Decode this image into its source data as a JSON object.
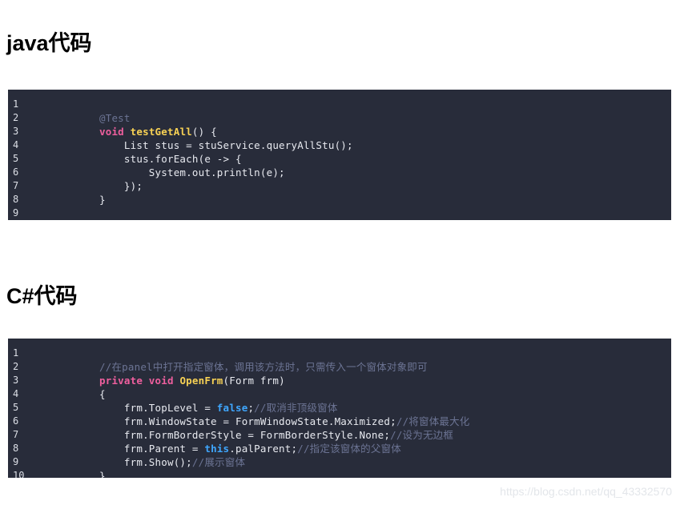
{
  "page": {
    "background_color": "#ffffff",
    "watermark": "https://blog.csdn.net/qq_43332570"
  },
  "sections": [
    {
      "id": "java",
      "heading": "java代码",
      "code_block": {
        "background_color": "#282c3a",
        "line_numbers": [
          "1",
          "2",
          "3",
          "4",
          "5",
          "6",
          "7",
          "8",
          "9"
        ],
        "lines": [
          "",
          "@Test",
          "void testGetAll() {",
          "    List stus = stuService.queryAllStu();",
          "    stus.forEach(e -> {",
          "        System.out.println(e);",
          "    });",
          "}",
          ""
        ]
      }
    },
    {
      "id": "csharp",
      "heading": "C#代码",
      "code_block": {
        "background_color": "#282c3a",
        "line_numbers": [
          "1",
          "2",
          "3",
          "4",
          "5",
          "6",
          "7",
          "8",
          "9",
          "10"
        ],
        "lines": [
          "",
          "//在panel中打开指定窗体，调用该方法时，只需传入一个窗体对象即可",
          "private void OpenFrm(Form frm)",
          "{",
          "    frm.TopLevel = false;//取消非顶级窗体",
          "    frm.WindowState = FormWindowState.Maximized;//将窗体最大化",
          "    frm.FormBorderStyle = FormBorderStyle.None;//设为无边框",
          "    frm.Parent = this.palParent;//指定该窗体的父窗体",
          "    frm.Show();//展示窗体",
          "}"
        ]
      }
    }
  ],
  "tokens": {
    "java": {
      "l2_anno": "@Test",
      "l3_kw_void": "void",
      "l3_fn": "testGetAll",
      "l3_tail": "() {",
      "l4": "    List stus = stuService.queryAllStu();",
      "l5": "    stus.forEach(e -> {",
      "l6": "        System.out.println(e);",
      "l7": "    });",
      "l8": "}"
    },
    "csharp": {
      "l2_comment": "//在panel中打开指定窗体，调用该方法时，只需传入一个窗体对象即可",
      "l3_kw": "private void",
      "l3_fn": "OpenFrm",
      "l3_tail": "(Form frm)",
      "l4": "{",
      "l5_head": "    frm.TopLevel = ",
      "l5_bool": "false",
      "l5_semi": ";",
      "l5_comment": "//取消非顶级窗体",
      "l6_head": "    frm.WindowState = FormWindowState.Maximized;",
      "l6_comment": "//将窗体最大化",
      "l7_head": "    frm.FormBorderStyle = FormBorderStyle.None;",
      "l7_comment": "//设为无边框",
      "l8_head": "    frm.Parent = ",
      "l8_this": "this",
      "l8_mid": ".palParent;",
      "l8_comment": "//指定该窗体的父窗体",
      "l9_head": "    frm.Show();",
      "l9_comment": "//展示窗体",
      "l10": "}"
    }
  },
  "colors": {
    "code_background": "#282c3a",
    "code_text": "#e8eaf0",
    "comment": "#6c7494",
    "keyword": "#ef5f9e",
    "function": "#f7d154",
    "boolean": "#3fa7ff",
    "line_number": "#dcdfe6",
    "heading": "#000000",
    "watermark": "#e3e6ea"
  }
}
